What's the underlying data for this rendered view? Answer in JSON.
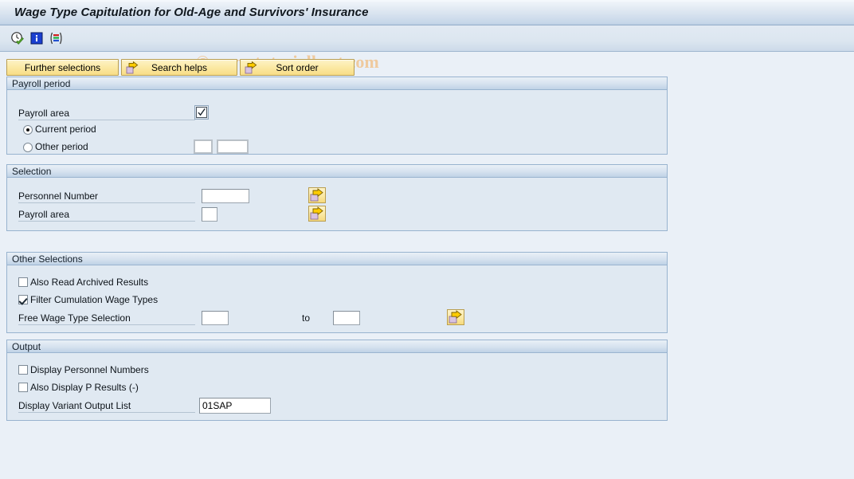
{
  "window": {
    "title": "Wage Type Capitulation for Old-Age and Survivors' Insurance"
  },
  "watermark": {
    "text": "© www.tutorialkart.com",
    "color": "#f0c89a"
  },
  "toolbar": {
    "icons": [
      {
        "name": "execute-clock-icon",
        "title": "Execute with Clock"
      },
      {
        "name": "information-icon",
        "title": "Information"
      },
      {
        "name": "variant-bars-icon",
        "title": "Get Variant"
      }
    ]
  },
  "button_row": {
    "further_selections": "Further selections",
    "search_helps": "Search helps",
    "sort_order": "Sort order"
  },
  "sections": {
    "payroll_period": {
      "header": "Payroll period",
      "payroll_area_label": "Payroll area",
      "payroll_area_value": "",
      "current_period_label": "Current period",
      "current_period_selected": true,
      "other_period_label": "Other period",
      "other_period_selected": false,
      "other_period_value_1": "",
      "other_period_value_2": ""
    },
    "selection": {
      "header": "Selection",
      "personnel_number_label": "Personnel Number",
      "personnel_number_value": "",
      "payroll_area_label": "Payroll area",
      "payroll_area_value": ""
    },
    "other_selections": {
      "header": "Other Selections",
      "also_read_archived_label": "Also Read Archived Results",
      "also_read_archived_checked": false,
      "filter_cumulation_label": "Filter Cumulation Wage Types",
      "filter_cumulation_checked": true,
      "free_wage_type_label": "Free Wage Type Selection",
      "free_wage_type_from": "",
      "to_label": "to",
      "free_wage_type_to": ""
    },
    "output": {
      "header": "Output",
      "display_personnel_numbers_label": "Display Personnel Numbers",
      "display_personnel_numbers_checked": false,
      "also_display_p_results_label": "Also Display P Results (-)",
      "also_display_p_results_checked": false,
      "display_variant_label": "Display Variant Output List",
      "display_variant_value": "01SAP"
    }
  },
  "colors": {
    "title_gradient_top": "#f2f6fb",
    "title_gradient_bottom": "#a8bfd8",
    "canvas": "#eaf0f7",
    "panel_bg": "#e0e9f2",
    "panel_border": "#98b3cf",
    "button_yellow": "#fbe9a4",
    "button_border": "#b99e50"
  }
}
